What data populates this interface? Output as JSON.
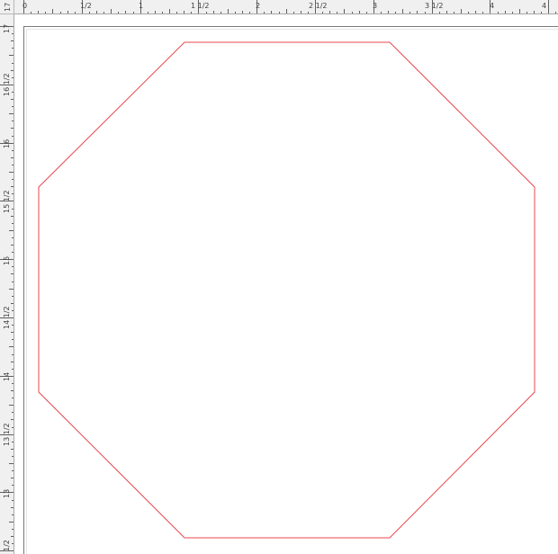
{
  "canvas": {
    "background": "#ffffff",
    "shape": {
      "type": "octagon",
      "stroke_color": "#e8474c",
      "fill": "none"
    }
  },
  "horizontal_ruler": {
    "labels": [
      {
        "text": "0"
      },
      {
        "text": "1/2"
      },
      {
        "text": "1"
      },
      {
        "text": "1 1/2"
      },
      {
        "text": "2"
      },
      {
        "text": "2 1/2"
      },
      {
        "text": "3"
      },
      {
        "text": "3 1/2"
      },
      {
        "text": "4"
      },
      {
        "text": "4"
      }
    ]
  },
  "vertical_ruler": {
    "corner_label": "17",
    "labels": [
      {
        "text": "17"
      },
      {
        "text": "16 1/2"
      },
      {
        "text": "16"
      },
      {
        "text": "15 1/2"
      },
      {
        "text": "15"
      },
      {
        "text": "14 1/2"
      },
      {
        "text": "14"
      },
      {
        "text": "13 1/2"
      },
      {
        "text": "13"
      },
      {
        "text": "1/2"
      }
    ]
  },
  "colors": {
    "ruler_bg": "#f0f0f0",
    "ruler_text": "#404040",
    "shape_stroke": "#e8474c"
  }
}
